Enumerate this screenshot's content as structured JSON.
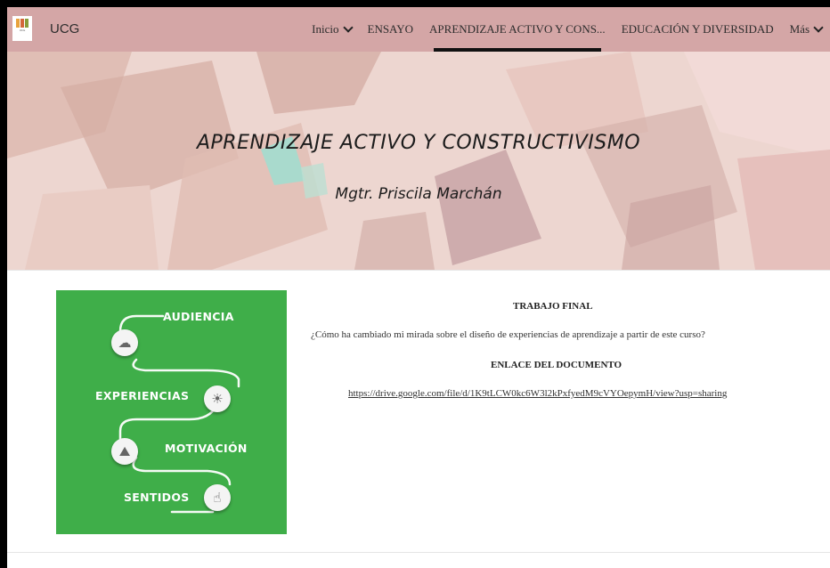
{
  "header": {
    "brand": "UCG",
    "logo_icon": "university-logo-icon",
    "menu": [
      {
        "label": "Inicio",
        "dropdown": true,
        "active": false
      },
      {
        "label": "ENSAYO",
        "dropdown": false,
        "active": false
      },
      {
        "label": "APRENDIZAJE ACTIVO Y CONS...",
        "dropdown": false,
        "active": true
      },
      {
        "label": "EDUCACIÓN Y DIVERSIDAD",
        "dropdown": false,
        "active": false
      },
      {
        "label": "Más",
        "dropdown": true,
        "active": false
      }
    ]
  },
  "hero": {
    "title": "APRENDIZAJE ACTIVO Y CONSTRUCTIVISMO",
    "subtitle": "Mgtr. Priscila Marchán"
  },
  "infographic": {
    "labels": [
      "AUDIENCIA",
      "EXPERIENCIAS",
      "MOTIVACIÓN",
      "SENTIDOS"
    ],
    "icons": [
      "brain-icon",
      "lightbulb-icon",
      "mountain-climb-icon",
      "touch-hand-icon"
    ]
  },
  "content": {
    "heading": "TRABAJO FINAL",
    "question": "¿Cómo ha cambiado mi mirada sobre el diseño de experiencias de aprendizaje a partir de este curso?",
    "link_heading": "ENLACE DEL DOCUMENTO",
    "link_text": "https://drive.google.com/file/d/1K9tLCW0kc6W3l2kPxfyedM9cVYOepymH/view?usp=sharing"
  },
  "colors": {
    "nav_bg": "#d4a6a6",
    "card_green": "#3fae49"
  }
}
